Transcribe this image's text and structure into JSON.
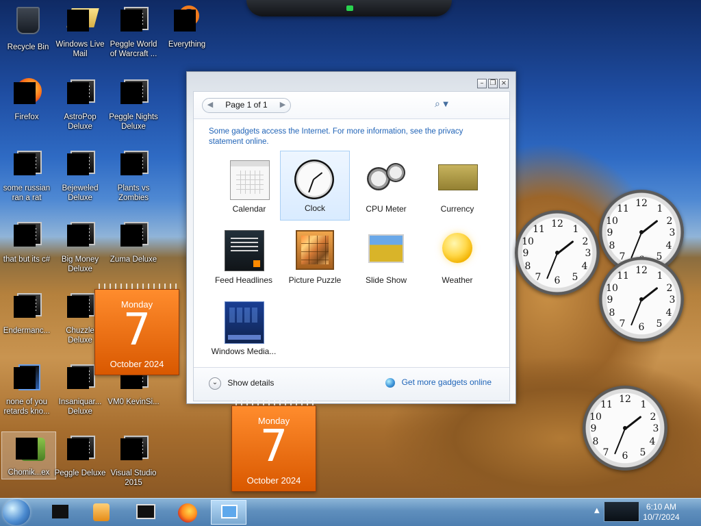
{
  "desktop": {
    "icons": [
      {
        "label": "Recycle Bin"
      },
      {
        "label": "Windows Live Mail"
      },
      {
        "label": "Peggle World of Warcraft ..."
      },
      {
        "label": "Everything"
      },
      {
        "label": "Firefox"
      },
      {
        "label": "AstroPop Deluxe"
      },
      {
        "label": "Peggle Nights Deluxe"
      },
      {
        "label": "some russian ran a rat"
      },
      {
        "label": "Bejeweled Deluxe"
      },
      {
        "label": "Plants vs Zombies"
      },
      {
        "label": "that but its c#"
      },
      {
        "label": "Big Money Deluxe"
      },
      {
        "label": "Zuma Deluxe"
      },
      {
        "label": "Endermanc..."
      },
      {
        "label": "Chuzzle Deluxe"
      },
      {
        "label": "none of you retards kno..."
      },
      {
        "label": "Insaniquar... Deluxe"
      },
      {
        "label": "VM0 KevinSi..."
      },
      {
        "label": "Chomik...ex"
      },
      {
        "label": "Peggle Deluxe"
      },
      {
        "label": "Visual Studio 2015"
      }
    ]
  },
  "gallery": {
    "page_label": "Page 1 of 1",
    "privacy_text": "Some gadgets access the Internet. For more information, see the privacy statement online.",
    "gadgets": [
      {
        "label": "Calendar"
      },
      {
        "label": "Clock"
      },
      {
        "label": "CPU Meter"
      },
      {
        "label": "Currency"
      },
      {
        "label": "Feed Headlines"
      },
      {
        "label": "Picture Puzzle"
      },
      {
        "label": "Slide Show"
      },
      {
        "label": "Weather"
      },
      {
        "label": "Windows Media..."
      }
    ],
    "show_details": "Show details",
    "get_more": "Get more gadgets online"
  },
  "calendars": [
    {
      "weekday": "Monday",
      "day": "7",
      "month": "October 2024"
    },
    {
      "weekday": "Monday",
      "day": "7",
      "month": "October 2024"
    }
  ],
  "clock_numbers": [
    "12",
    "1",
    "2",
    "3",
    "4",
    "5",
    "6",
    "7",
    "8",
    "9",
    "10",
    "11"
  ],
  "taskbar": {
    "time": "6:10 AM",
    "date": "10/7/2024"
  },
  "colors": {
    "accent": "#1e64b8",
    "calendar_orange": "#f27a1e",
    "taskbar_blue": "#5f8fbd"
  },
  "icons": {
    "search": "search-icon",
    "dropdown": "chevron-down-icon",
    "details": "chevron-down-circle-icon",
    "globe": "globe-icon",
    "start": "windows-start-icon"
  }
}
